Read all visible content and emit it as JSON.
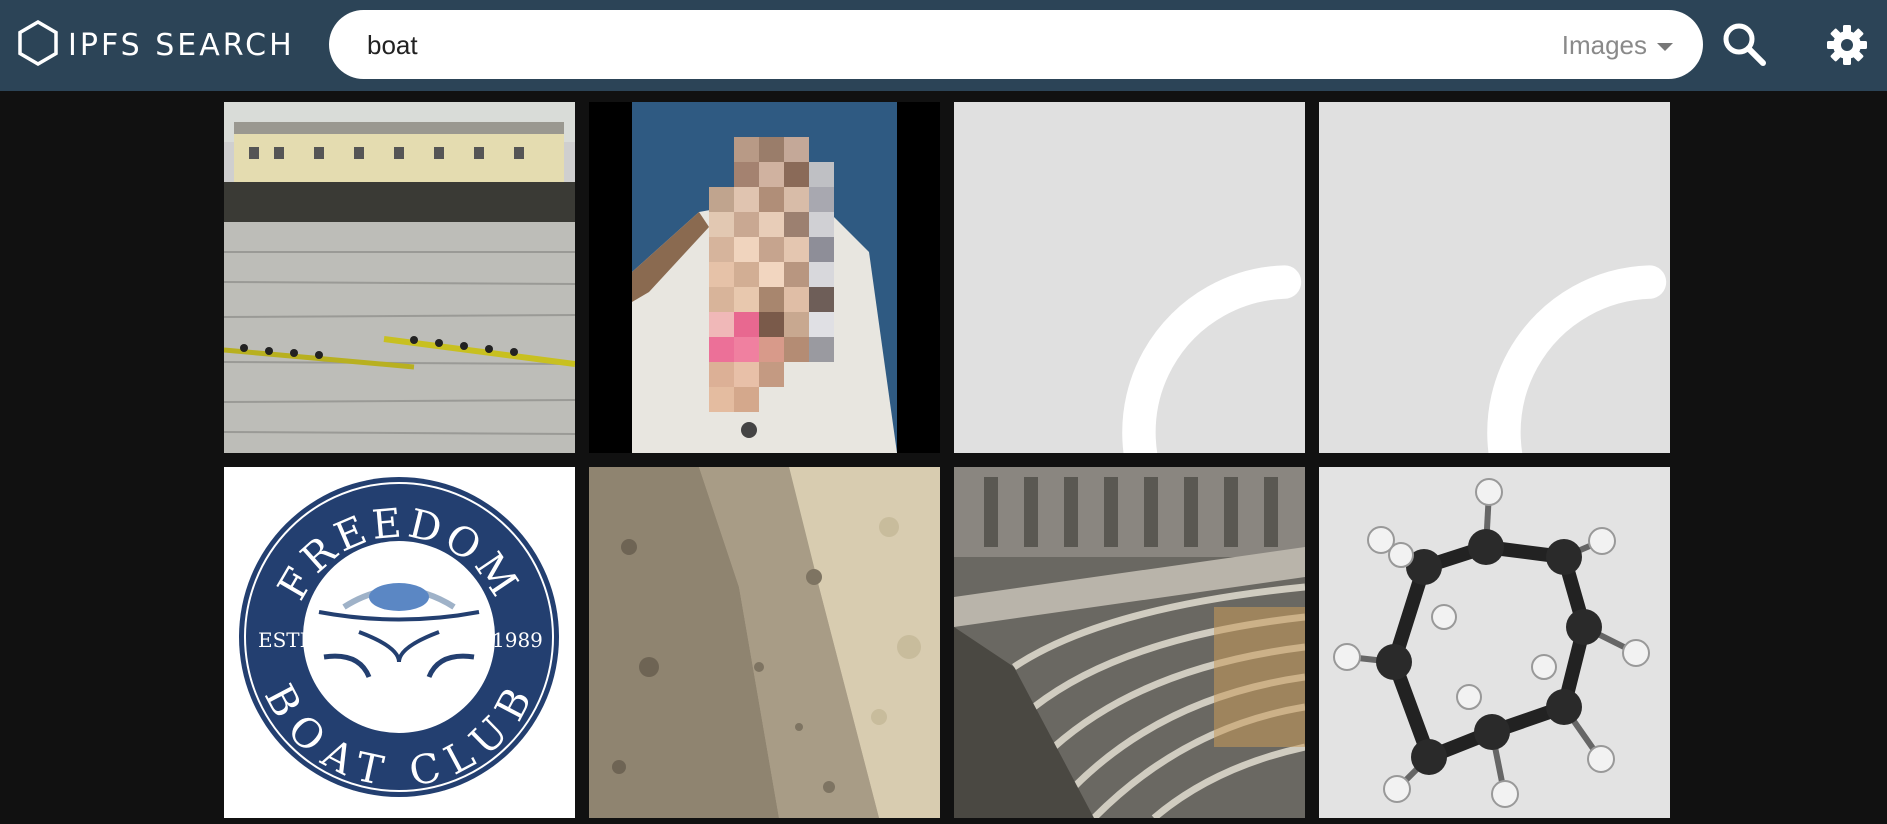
{
  "header": {
    "logo_text": "IPFS SEARCH",
    "logo_icon": "hexagon-icon",
    "bg_color": "#2c4457"
  },
  "search": {
    "query": "boat",
    "type_selected": "Images",
    "search_icon": "search-icon",
    "settings_icon": "gear-icon"
  },
  "results": {
    "items": [
      {
        "kind": "image",
        "description": "rowing-race-photo"
      },
      {
        "kind": "image",
        "description": "boat-photo-pixelated"
      },
      {
        "kind": "loading"
      },
      {
        "kind": "loading"
      },
      {
        "kind": "image",
        "description": "freedom-boat-club-logo",
        "logo_text": {
          "top": "FREEDOM",
          "bottom": "BOAT CLUB",
          "left": "ESTD",
          "right": "1989"
        }
      },
      {
        "kind": "image",
        "description": "trench-photo"
      },
      {
        "kind": "image",
        "description": "ship-hull-frames-photo"
      },
      {
        "kind": "image",
        "description": "cyclooctane-molecule-model"
      }
    ]
  }
}
